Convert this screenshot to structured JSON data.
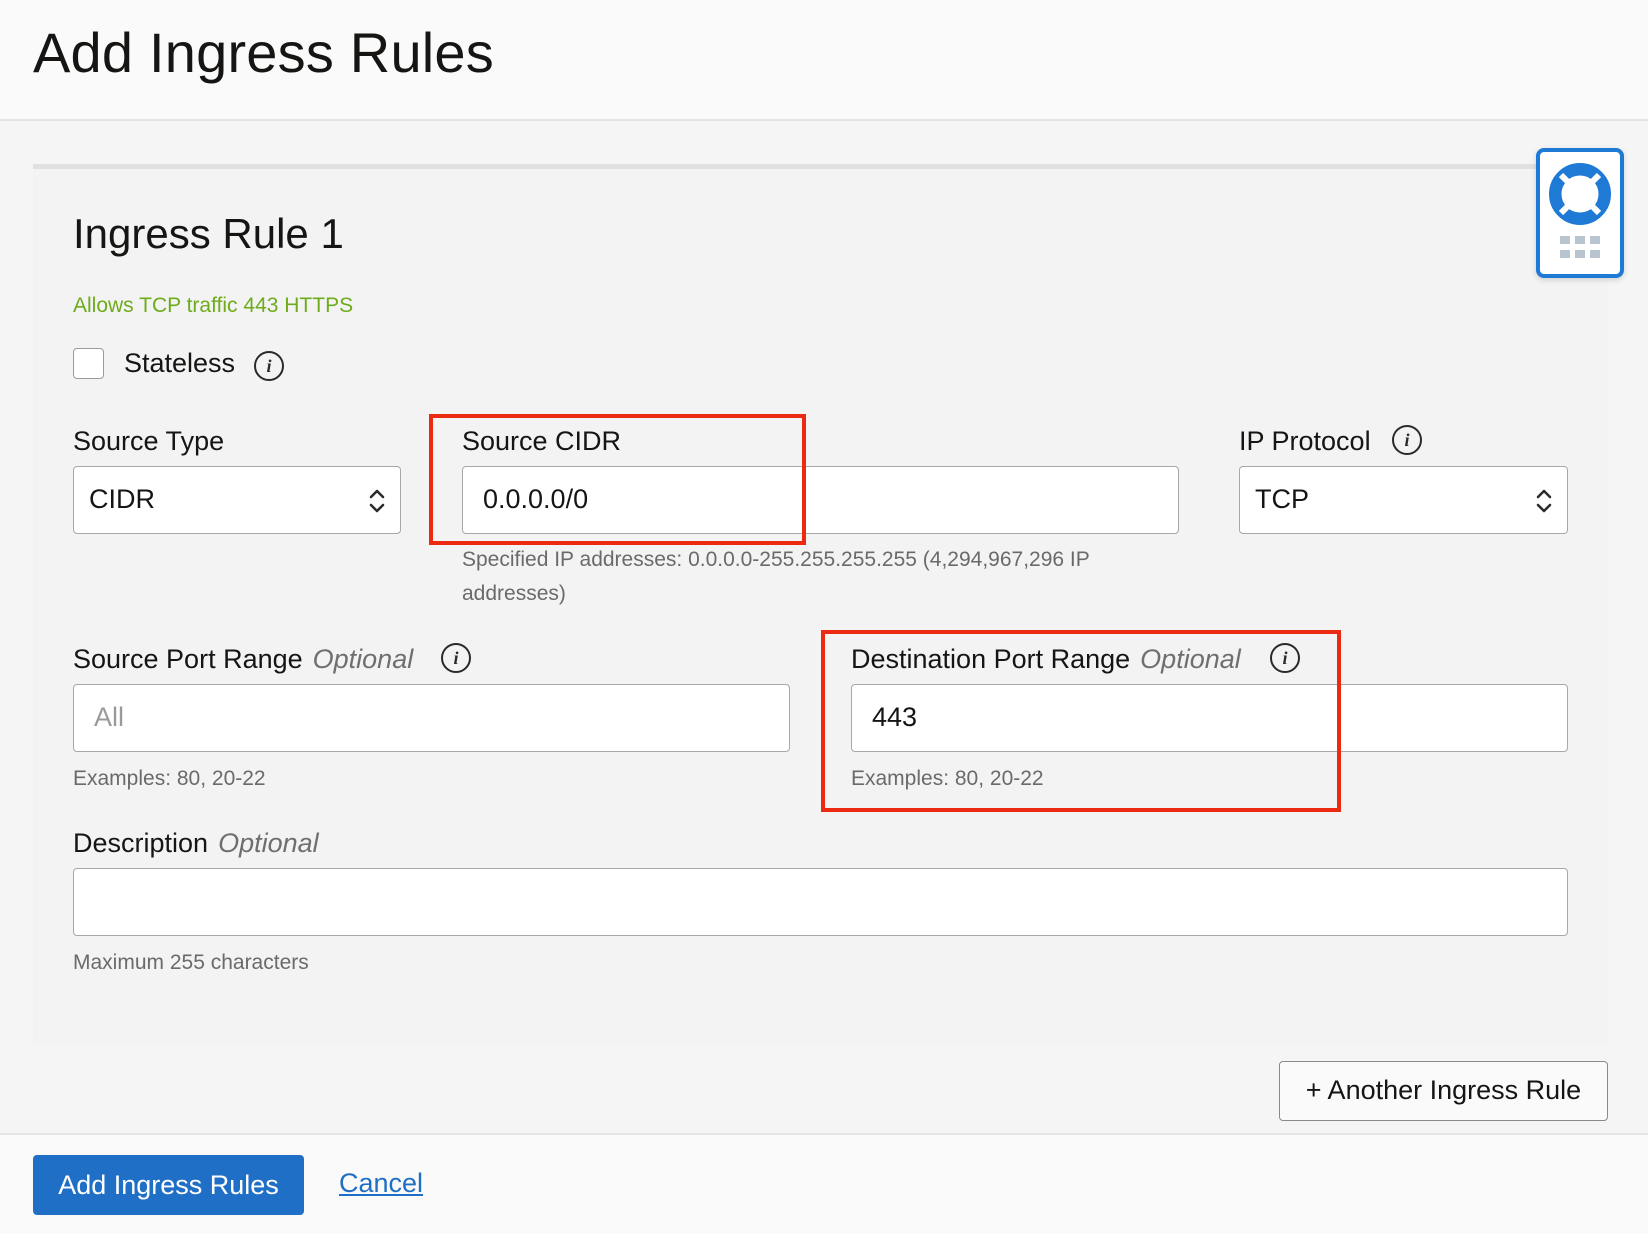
{
  "page": {
    "title": "Add Ingress Rules"
  },
  "rule": {
    "title": "Ingress Rule 1",
    "description_text": "Allows TCP traffic 443 HTTPS",
    "stateless_label": "Stateless",
    "stateless_checked": false,
    "source_type": {
      "label": "Source Type",
      "value": "CIDR"
    },
    "source_cidr": {
      "label": "Source CIDR",
      "value": "0.0.0.0/0",
      "hint_line1": "Specified IP addresses: 0.0.0.0-255.255.255.255 (4,294,967,296 IP",
      "hint_line2": "addresses)"
    },
    "ip_protocol": {
      "label": "IP Protocol",
      "value": "TCP"
    },
    "source_port_range": {
      "label": "Source Port Range",
      "optional": "Optional",
      "placeholder": "All",
      "hint": "Examples: 80, 20-22"
    },
    "destination_port_range": {
      "label": "Destination Port Range",
      "optional": "Optional",
      "value": "443",
      "hint": "Examples: 80, 20-22"
    },
    "description": {
      "label": "Description",
      "optional": "Optional",
      "value": "",
      "hint": "Maximum 255 characters"
    }
  },
  "actions": {
    "another_rule": "+ Another Ingress Rule",
    "submit": "Add Ingress Rules",
    "cancel": "Cancel"
  },
  "icons": {
    "info": "info-icon",
    "help": "lifebuoy-icon",
    "apps": "grid-icon"
  },
  "colors": {
    "primary": "#1f6fc6",
    "success_text": "#6eac1b",
    "highlight": "#ec2a12",
    "help_border": "#1f7ad6"
  }
}
